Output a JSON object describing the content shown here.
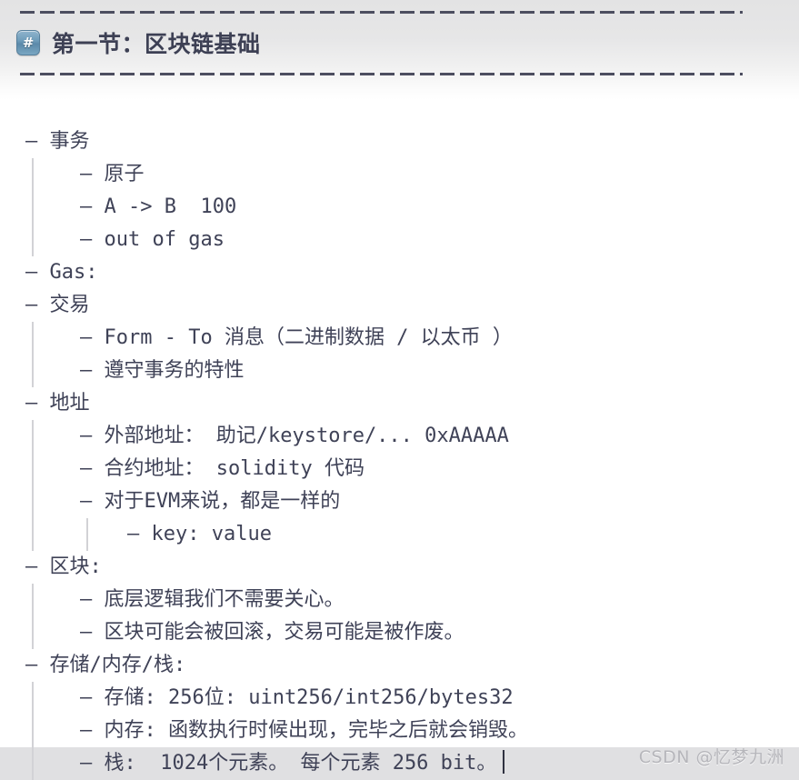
{
  "header": {
    "rule_char": "-",
    "icon_glyph": "#",
    "icon_name": "heading-hash-icon",
    "title": "第一节：区块链基础"
  },
  "colors": {
    "text": "#3f4257",
    "header_band": "#e3e3e4",
    "indent_guide": "#d2d2d6",
    "current_line_highlight": "#e0e0e2",
    "icon_blue": "#6e9cba",
    "caret": "#2f3140",
    "watermark": "#b6b6bb"
  },
  "outline": [
    {
      "level": 1,
      "text": "— 事务",
      "guides": []
    },
    {
      "level": 2,
      "text": "— 原子",
      "guides": [
        1
      ]
    },
    {
      "level": 2,
      "text": "— A -> B  100",
      "guides": [
        1
      ]
    },
    {
      "level": 2,
      "text": "— out of gas",
      "guides": [
        1
      ]
    },
    {
      "level": 1,
      "text": "— Gas:",
      "guides": []
    },
    {
      "level": 1,
      "text": "— 交易",
      "guides": []
    },
    {
      "level": 2,
      "text": "— Form - To 消息（二进制数据 / 以太币 ）",
      "guides": [
        1
      ]
    },
    {
      "level": 2,
      "text": "— 遵守事务的特性",
      "guides": [
        1
      ]
    },
    {
      "level": 1,
      "text": "— 地址",
      "guides": []
    },
    {
      "level": 2,
      "text": "— 外部地址： 助记/keystore/... 0xAAAAA",
      "guides": [
        1
      ]
    },
    {
      "level": 2,
      "text": "— 合约地址： solidity 代码",
      "guides": [
        1
      ]
    },
    {
      "level": 2,
      "text": "— 对于EVM来说，都是一样的",
      "guides": [
        1
      ]
    },
    {
      "level": 3,
      "text": "— key: value",
      "guides": [
        1,
        2
      ]
    },
    {
      "level": 1,
      "text": "— 区块:",
      "guides": []
    },
    {
      "level": 2,
      "text": "— 底层逻辑我们不需要关心。",
      "guides": [
        1
      ]
    },
    {
      "level": 2,
      "text": "— 区块可能会被回滚，交易可能是被作废。",
      "guides": [
        1
      ]
    },
    {
      "level": 1,
      "text": "— 存储/内存/栈:",
      "guides": []
    },
    {
      "level": 2,
      "text": "— 存储: 256位: uint256/int256/bytes32",
      "guides": [
        1
      ]
    },
    {
      "level": 2,
      "text": "— 内存: 函数执行时候出现，完毕之后就会销毁。",
      "guides": [
        1
      ]
    },
    {
      "level": 2,
      "text": "— 栈:  1024个元素。 每个元素 256 bit。",
      "guides": [
        1
      ],
      "current": true,
      "caret": true
    }
  ],
  "watermark": {
    "text": "CSDN @忆梦九洲"
  }
}
